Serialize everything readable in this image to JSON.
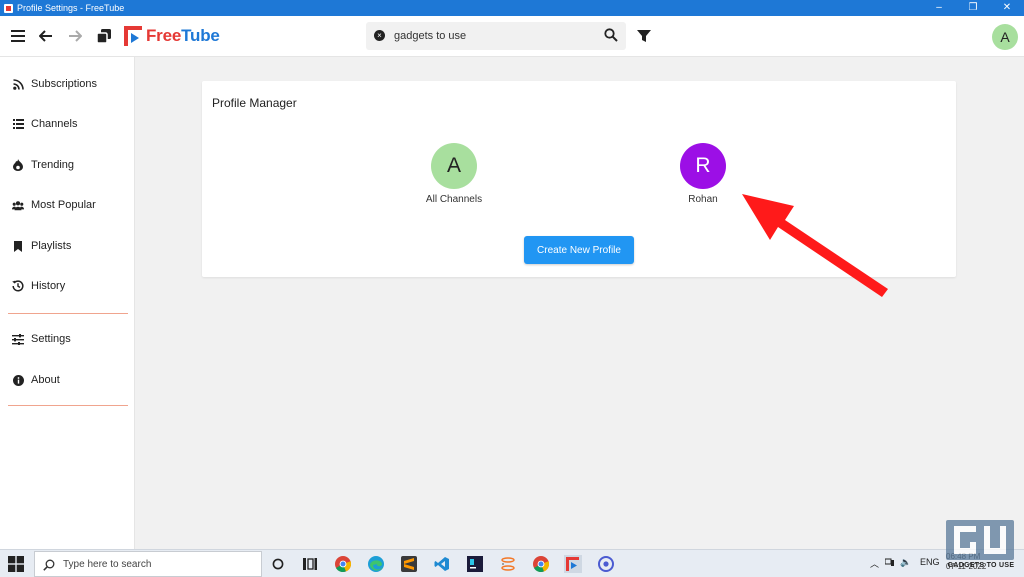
{
  "window": {
    "title": "Profile Settings - FreeTube",
    "controls": {
      "minimize": "–",
      "maximize": "❐",
      "close": "✕"
    }
  },
  "header": {
    "logo_free": "Free",
    "logo_tube": "Tube",
    "search_value": "gadgets to use",
    "avatar_letter": "A"
  },
  "sidebar": {
    "items": [
      {
        "label": "Subscriptions",
        "icon": "rss-icon"
      },
      {
        "label": "Channels",
        "icon": "list-icon"
      },
      {
        "label": "Trending",
        "icon": "fire-icon"
      },
      {
        "label": "Most Popular",
        "icon": "users-icon"
      },
      {
        "label": "Playlists",
        "icon": "bookmark-icon"
      },
      {
        "label": "History",
        "icon": "history-icon"
      },
      {
        "label": "Settings",
        "icon": "sliders-icon"
      },
      {
        "label": "About",
        "icon": "info-icon"
      }
    ]
  },
  "main": {
    "card_title": "Profile Manager",
    "profiles": [
      {
        "letter": "A",
        "name": "All Channels",
        "color": "#a8df9e",
        "text_color": "#222222"
      },
      {
        "letter": "R",
        "name": "Rohan",
        "color": "#9c0fe6",
        "text_color": "#ffffff"
      }
    ],
    "create_button": "Create New Profile"
  },
  "taskbar": {
    "search_placeholder": "Type here to search",
    "tray_lang": "ENG",
    "tray_time": "06:48 PM",
    "tray_date": "07-11-2022"
  },
  "watermark": {
    "text": "GADGETS TO USE"
  },
  "colors": {
    "accent": "#2196f3",
    "brand_red": "#e53935",
    "brand_blue": "#1e78d6",
    "arrow": "#ff1a1a"
  }
}
